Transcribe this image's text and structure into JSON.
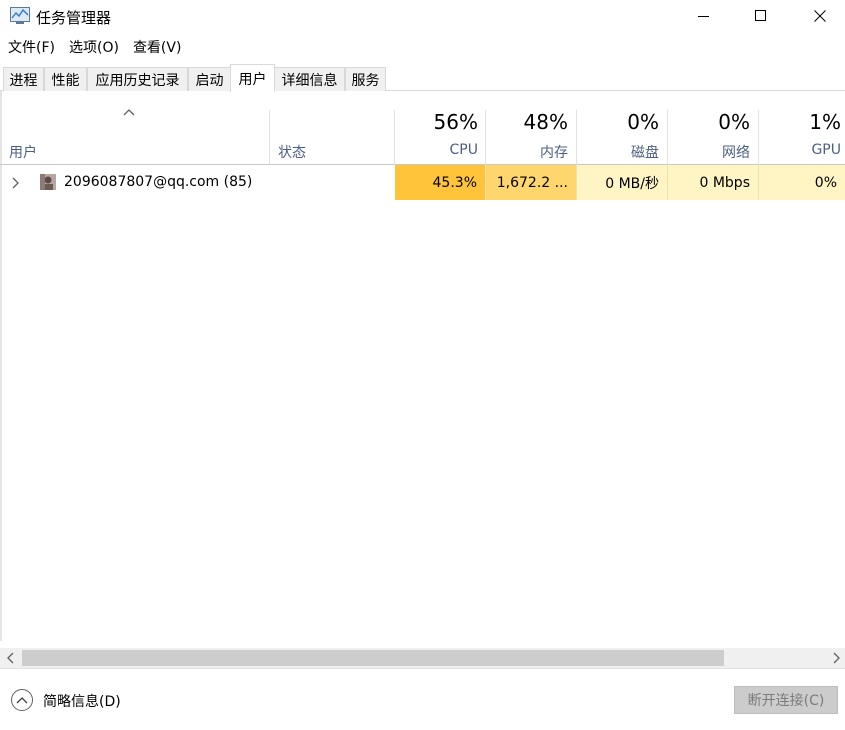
{
  "window": {
    "title": "任务管理器",
    "minimize_icon": "minimize-icon",
    "maximize_icon": "maximize-icon",
    "close_icon": "close-icon"
  },
  "menu": [
    {
      "label": "文件(F)"
    },
    {
      "label": "选项(O)"
    },
    {
      "label": "查看(V)"
    }
  ],
  "tabs": [
    {
      "label": "进程"
    },
    {
      "label": "性能"
    },
    {
      "label": "应用历史记录"
    },
    {
      "label": "启动"
    },
    {
      "label": "用户",
      "active": true
    },
    {
      "label": "详细信息"
    },
    {
      "label": "服务"
    }
  ],
  "columns": {
    "user": "用户",
    "status": "状态",
    "cpu": {
      "percent": "56%",
      "name": "CPU"
    },
    "memory": {
      "percent": "48%",
      "name": "内存"
    },
    "disk": {
      "percent": "0%",
      "name": "磁盘"
    },
    "network": {
      "percent": "0%",
      "name": "网络"
    },
    "gpu": {
      "percent": "1%",
      "name": "GPU"
    }
  },
  "rows": [
    {
      "user": "2096087807@qq.com (85)",
      "status": "",
      "cpu": "45.3%",
      "memory": "1,672.2 ...",
      "disk": "0 MB/秒",
      "network": "0 Mbps",
      "gpu": "0%"
    }
  ],
  "heat_colors": {
    "cpu": "#ffc43a",
    "memory": "#ffd66e",
    "disk": "#fff4c4",
    "network": "#fff4c4",
    "gpu": "#fff4c4"
  },
  "footer": {
    "fewer_details": "简略信息(D)",
    "disconnect": "断开连接(C)"
  }
}
